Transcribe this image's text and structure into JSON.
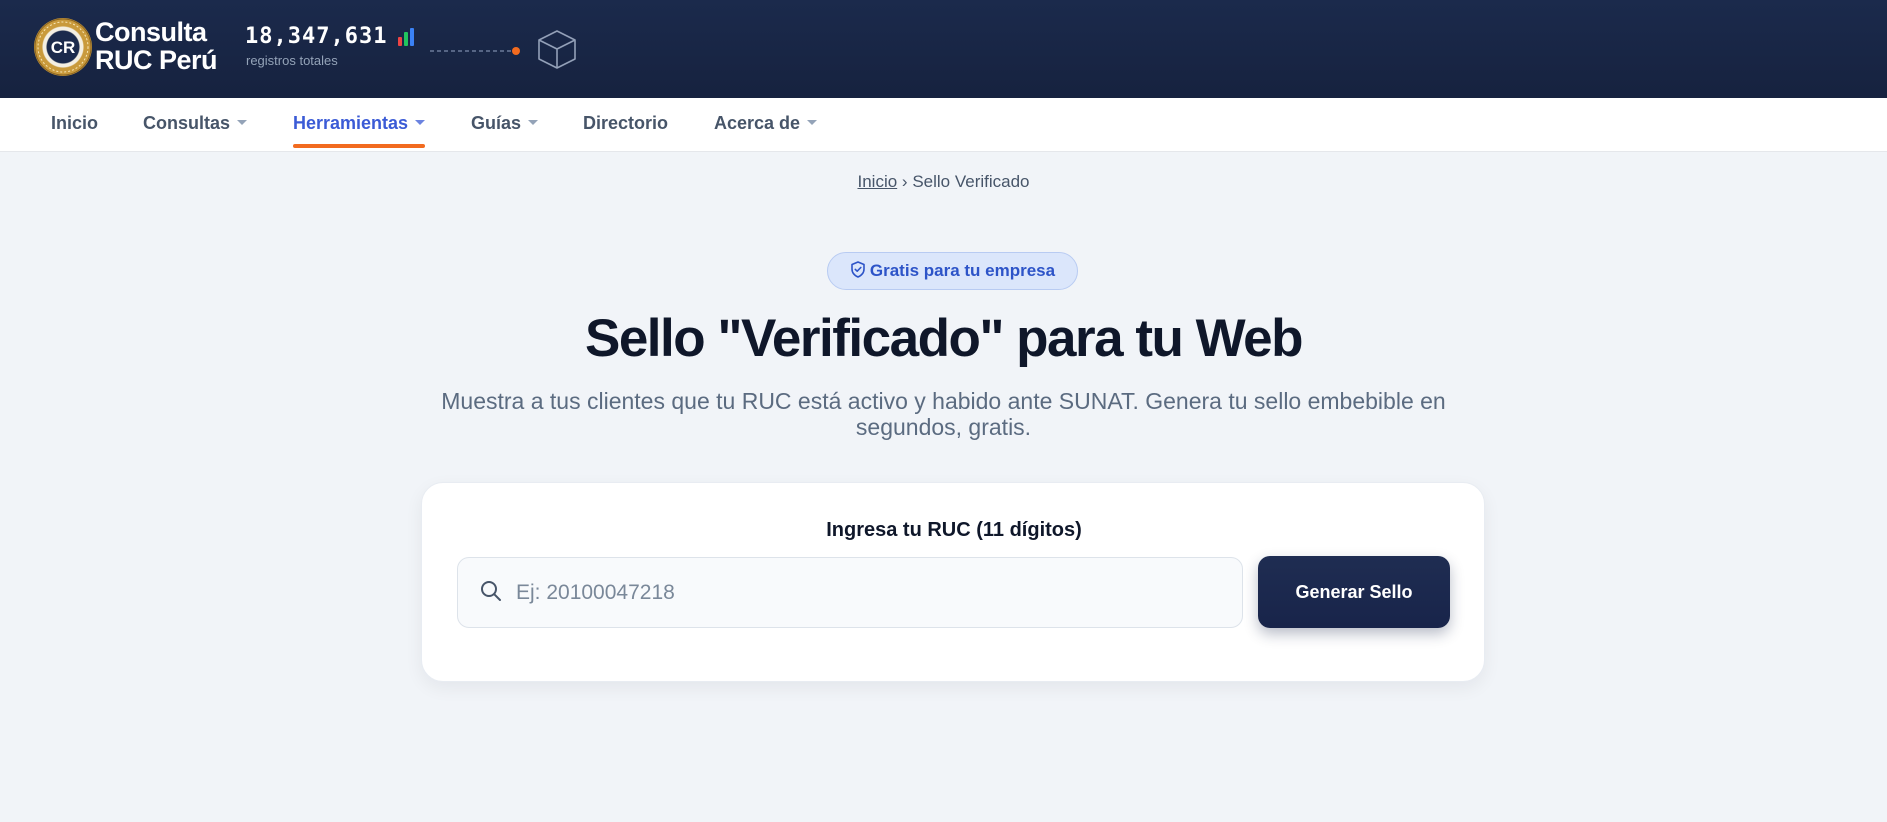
{
  "header": {
    "brand_line1": "Consulta",
    "brand_line2": "RUC Perú",
    "logo_text": "CR",
    "stats_count": "18,347,631",
    "stats_label": "registros totales",
    "colors": {
      "background": "#1b2a4c",
      "accent": "#f26b1f"
    }
  },
  "nav": {
    "items": [
      {
        "label": "Inicio",
        "dropdown": false,
        "active": false
      },
      {
        "label": "Consultas",
        "dropdown": true,
        "active": false
      },
      {
        "label": "Herramientas",
        "dropdown": true,
        "active": true
      },
      {
        "label": "Guías",
        "dropdown": true,
        "active": false
      },
      {
        "label": "Directorio",
        "dropdown": false,
        "active": false
      },
      {
        "label": "Acerca de",
        "dropdown": true,
        "active": false
      }
    ]
  },
  "breadcrumb": {
    "home": "Inicio",
    "separator": "›",
    "current": "Sello Verificado"
  },
  "hero": {
    "badge": "Gratis para tu empresa",
    "title": "Sello \"Verificado\" para tu Web",
    "subtitle": "Muestra a tus clientes que tu RUC está activo y habido ante SUNAT. Genera tu sello embebible en segundos, gratis."
  },
  "form": {
    "label": "Ingresa tu RUC (11 dígitos)",
    "input_value": "",
    "input_placeholder": "Ej: 20100047218",
    "button_label": "Generar Sello"
  },
  "icons": {
    "logo": "company-seal-icon",
    "stats": "bar-chart-icon",
    "cube": "cube-icon",
    "badge": "shield-check-icon",
    "search": "search-icon"
  }
}
